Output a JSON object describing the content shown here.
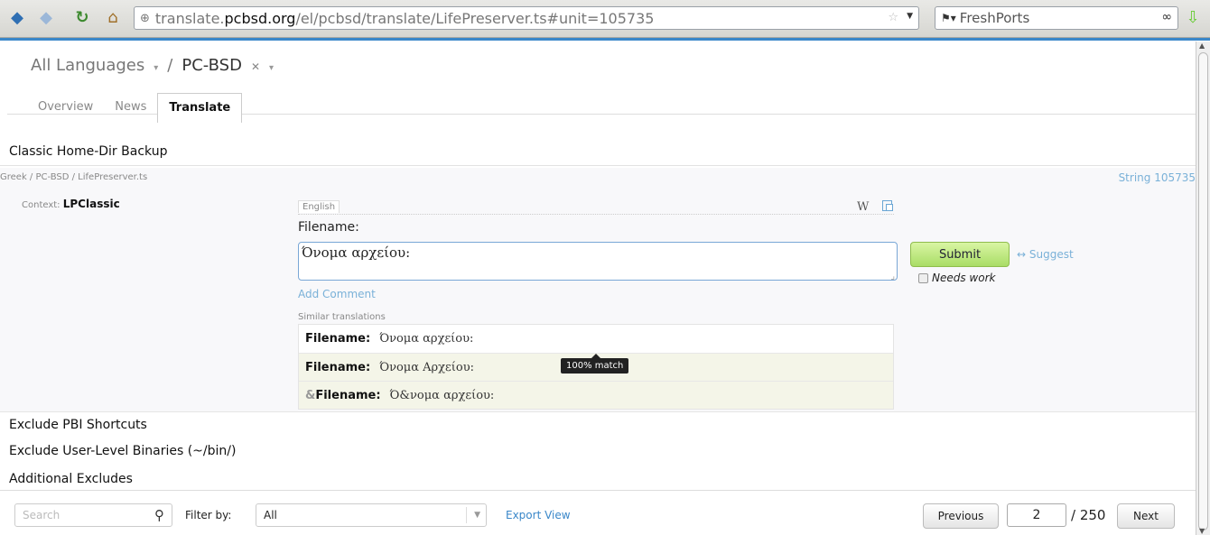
{
  "browser": {
    "url_prefix": "translate.",
    "url_domain": "pcbsd.org",
    "url_path": "/el/pcbsd/translate/LifePreserver.ts#unit=105735",
    "search_engine": "FreshPorts"
  },
  "breadcrumb": {
    "project_group": "All Languages",
    "separator": "/",
    "project": "PC-BSD"
  },
  "tabs": [
    {
      "label": "Overview"
    },
    {
      "label": "News"
    },
    {
      "label": "Translate"
    }
  ],
  "unit": {
    "title": "Classic Home-Dir Backup",
    "file_path": "Greek / PC-BSD / LifePreserver.ts",
    "string_id": "String 105735",
    "context_label": "Context:",
    "context_value": "LPClassic",
    "source_lang": "English",
    "source_text": "Filename:",
    "translation": "Όνομα αρχείου:",
    "submit_label": "Submit",
    "suggest_label": "↔ Suggest",
    "needs_work_label": "Needs work",
    "add_comment": "Add Comment",
    "similar_label": "Similar translations",
    "tooltip": "100% match"
  },
  "similar": [
    {
      "amp": "",
      "source": "Filename:",
      "target": "Όνομα αρχείου:"
    },
    {
      "amp": "",
      "source": "Filename:",
      "target": "Όνομα Αρχείου:"
    },
    {
      "amp": "&",
      "source": "Filename:",
      "target": "Ό&νομα αρχείου:"
    }
  ],
  "other_units": [
    "Exclude PBI Shortcuts",
    "Exclude User-Level Binaries (~/bin/)",
    "Additional Excludes"
  ],
  "footer": {
    "search_placeholder": "Search",
    "filter_label": "Filter by:",
    "filter_value": "All",
    "export_label": "Export View",
    "prev_label": "Previous",
    "page_current": "2",
    "page_total": "/ 250",
    "next_label": "Next"
  }
}
